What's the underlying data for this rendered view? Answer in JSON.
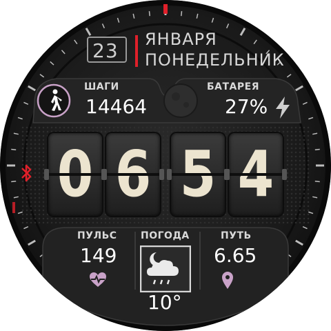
{
  "date": {
    "day": "23",
    "month": "ЯНВАРЯ",
    "weekday": "ПОНЕДЕЛЬНИК"
  },
  "steps": {
    "label": "ШАГИ",
    "value": "14464",
    "icon": "walking-person-icon"
  },
  "battery": {
    "label": "БАТАРЕЯ",
    "value": "27%",
    "icon": "lightning-bolt-icon"
  },
  "time": {
    "digits": [
      "0",
      "6",
      "5",
      "4"
    ]
  },
  "bluetooth": {
    "icon": "bluetooth-icon",
    "color": "#e0202a"
  },
  "pulse": {
    "label": "ПУЛЬС",
    "value": "149",
    "icon": "heart-pulse-icon"
  },
  "weather": {
    "label": "ПОГОДА",
    "temperature": "10°",
    "icon": "moon-cloud-rain-icon"
  },
  "distance": {
    "label": "ПУТЬ",
    "value": "6.65",
    "icon": "location-pin-icon"
  },
  "colors": {
    "accent": "#e0202a",
    "digit": "#ece4cf",
    "icon_tint": "#c9a2c8"
  }
}
